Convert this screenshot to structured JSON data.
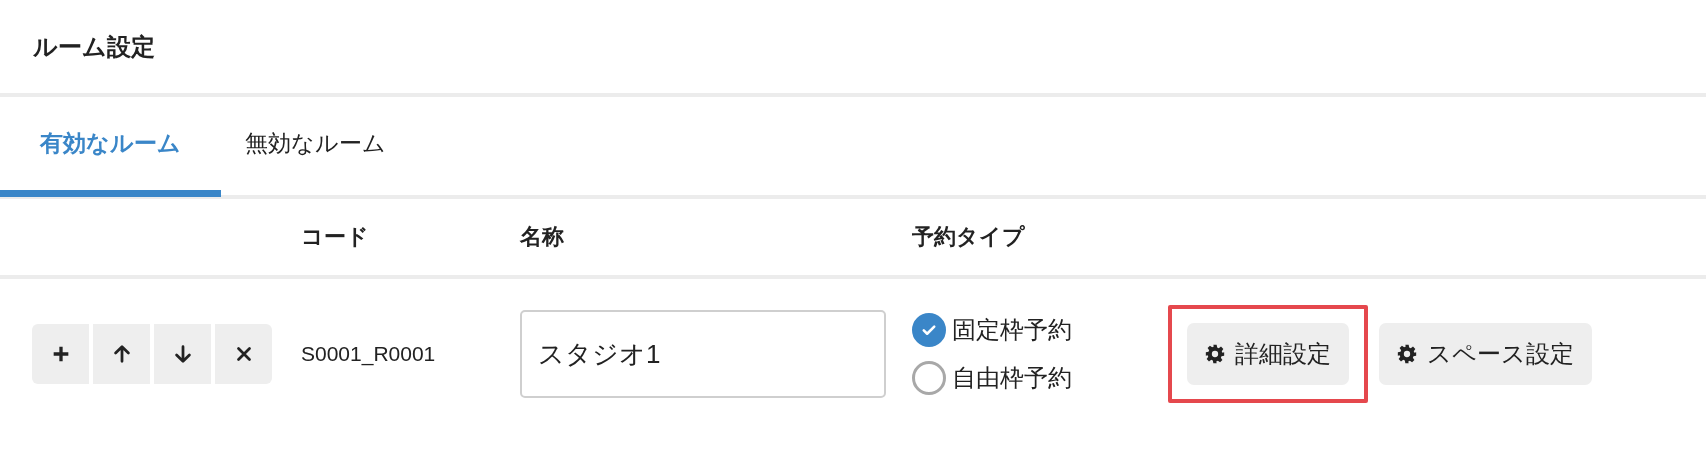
{
  "page_title": "ルーム設定",
  "tabs": [
    {
      "label": "有効なルーム",
      "selected": true
    },
    {
      "label": "無効なルーム",
      "selected": false
    }
  ],
  "table": {
    "columns": [
      "コード",
      "名称",
      "予約タイプ"
    ],
    "rows": [
      {
        "row_actions": [
          {
            "kind": "add"
          },
          {
            "kind": "up"
          },
          {
            "kind": "down"
          },
          {
            "kind": "remove"
          }
        ],
        "code": "S0001_R0001",
        "name": "スタジオ1",
        "reservation_types": [
          {
            "label": "固定枠予約",
            "selected": true
          },
          {
            "label": "自由枠予約",
            "selected": false
          }
        ],
        "buttons": [
          {
            "label": "詳細設定",
            "highlighted": true
          },
          {
            "label": "スペース設定",
            "highlighted": false
          }
        ]
      }
    ]
  }
}
